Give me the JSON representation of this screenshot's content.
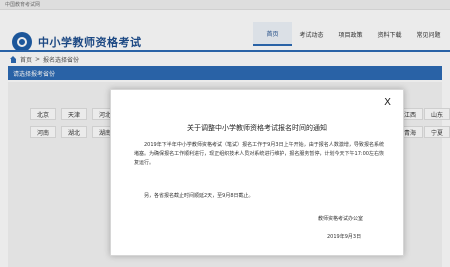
{
  "topbar": {
    "text": "中国教育考试网"
  },
  "header": {
    "title": "中小学教师资格考试"
  },
  "nav": [
    {
      "label": "首页",
      "active": true
    },
    {
      "label": "考试动态",
      "active": false
    },
    {
      "label": "项目政策",
      "active": false
    },
    {
      "label": "资料下载",
      "active": false
    },
    {
      "label": "常见问题",
      "active": false
    }
  ],
  "breadcrumb": {
    "home": "首页",
    "sep": ">",
    "current": "报名选择省份"
  },
  "section": {
    "title": "请选择报考省份"
  },
  "provinces": {
    "row1_left": [
      "北京",
      "天津",
      "河北"
    ],
    "row1_right": [
      "江西",
      "山东"
    ],
    "row2_left": [
      "河南",
      "湖北",
      "湖南"
    ],
    "row2_right": [
      "青海",
      "宁夏"
    ]
  },
  "modal": {
    "close": "X",
    "title": "关于调整中小学教师资格考试报名时间的通知",
    "para1": "2019年下半年中小学教师资格考试（笔试）报名工作于9月3日上午开始，由于报名人数激增，导致报名系统堵塞。为确保报名工作顺利进行，现正组织技术人员对系统进行维护，报名服务暂停，计划今天下午17:00左右恢复运行。",
    "para2": "另，各省报名截止时间顺延2天，至9月8日截止。",
    "signature": "教师资格考试办公室",
    "date": "2019年9月3日"
  }
}
